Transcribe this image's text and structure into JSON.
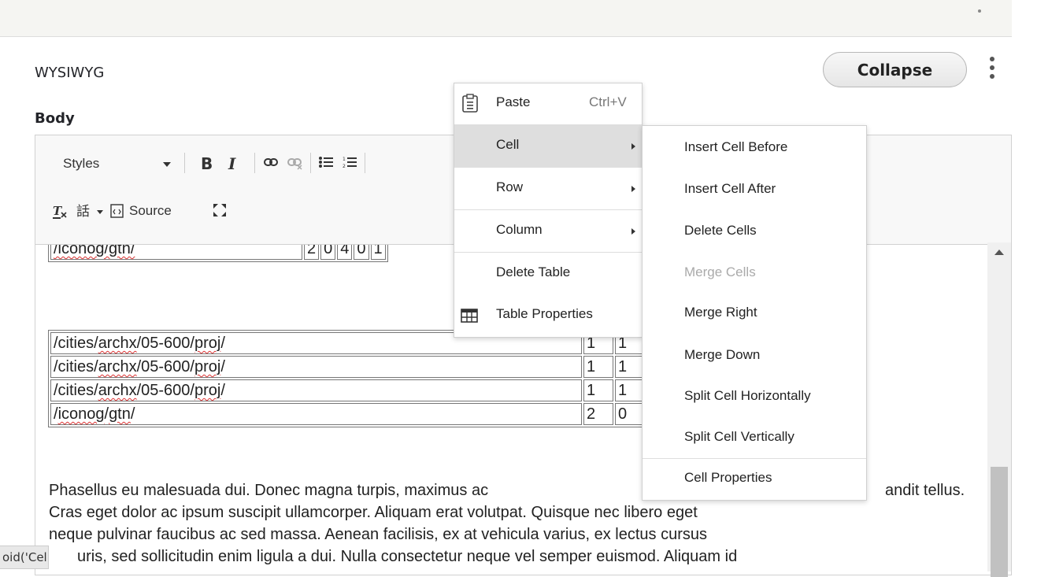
{
  "section": {
    "title": "WYSIWYG",
    "collapse_label": "Collapse"
  },
  "field": {
    "label": "Body"
  },
  "toolbar": {
    "styles_label": "Styles",
    "bold_label": "B",
    "italic_label": "I",
    "source_label": "Source",
    "icons": [
      "chevron-down-icon",
      "link-icon",
      "unlink-icon",
      "bulleted-list-icon",
      "numbered-list-icon",
      "remove-format-icon",
      "language-icon",
      "source-icon",
      "maximize-icon"
    ]
  },
  "content": {
    "partial_row": {
      "path": "/iconog/gtn/",
      "cells": [
        "2",
        "0",
        "4",
        "0",
        "1"
      ]
    },
    "table_rows": [
      {
        "path_prefix": "/cities/",
        "path_mid": "archx",
        "path_suffix": "/05-600/",
        "path_end": "proj",
        "path_tail": "/",
        "col1": "1",
        "col2": "1"
      },
      {
        "path_prefix": "/cities/",
        "path_mid": "archx",
        "path_suffix": "/05-600/",
        "path_end": "proj",
        "path_tail": "/",
        "col1": "1",
        "col2": "1"
      },
      {
        "path_prefix": "/cities/",
        "path_mid": "archx",
        "path_suffix": "/05-600/",
        "path_end": "proj",
        "path_tail": "/",
        "col1": "1",
        "col2": "1"
      },
      {
        "path_prefix": "/",
        "path_mid": "iconog",
        "path_suffix": "/",
        "path_end": "gtn",
        "path_tail": "/",
        "col1": "2",
        "col2": "0"
      }
    ],
    "paragraph_lines": [
      "Phasellus eu malesuada dui. Donec magna turpis, maximus ac",
      "andit tellus.",
      "Cras eget dolor ac ipsum suscipit ullamcorper. Aliquam erat volutpat. Quisque nec libero eget",
      "neque pulvinar faucibus ac sed massa. Aenean facilisis, ex at vehicula varius, ex lectus cursus",
      "uris, sed sollicitudin enim ligula a dui. Nulla consectetur neque vel semper euismod. Aliquam id"
    ]
  },
  "context_menu": {
    "items": [
      {
        "label": "Paste",
        "shortcut": "Ctrl+V",
        "icon": "paste-icon"
      },
      {
        "label": "Cell",
        "submenu": true
      },
      {
        "label": "Row",
        "submenu": true
      },
      {
        "label": "Column",
        "submenu": true
      },
      {
        "label": "Delete Table"
      },
      {
        "label": "Table Properties",
        "icon": "table-icon"
      }
    ]
  },
  "cell_submenu": {
    "items": [
      {
        "label": "Insert Cell Before"
      },
      {
        "label": "Insert Cell After"
      },
      {
        "label": "Delete Cells"
      },
      {
        "label": "Merge Cells",
        "disabled": true
      },
      {
        "label": "Merge Right"
      },
      {
        "label": "Merge Down"
      },
      {
        "label": "Split Cell Horizontally"
      },
      {
        "label": "Split Cell Vertically"
      },
      {
        "label": "Cell Properties"
      }
    ]
  },
  "status_bar": {
    "text": "oid('Cell')"
  },
  "colors": {
    "menu_hover": "#dedede",
    "spell_underline": "#dd3333",
    "toolbar_bg": "#f8f8f8"
  }
}
